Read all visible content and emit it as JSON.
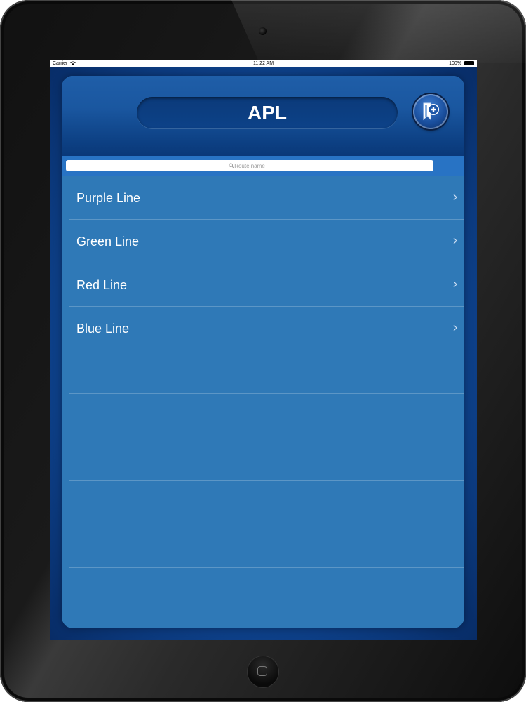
{
  "status_bar": {
    "carrier": "Carrier",
    "time": "11:22 AM",
    "battery": "100%"
  },
  "header": {
    "title": "APL",
    "add_button_icon": "bookmark-add-icon"
  },
  "search": {
    "placeholder": "Route name",
    "icon": "search-icon"
  },
  "routes": [
    {
      "label": "Purple Line"
    },
    {
      "label": "Green Line"
    },
    {
      "label": "Red Line"
    },
    {
      "label": "Blue Line"
    }
  ],
  "colors": {
    "accent": "#2f79b7",
    "header": "#0c3f82",
    "text": "#ffffff"
  }
}
